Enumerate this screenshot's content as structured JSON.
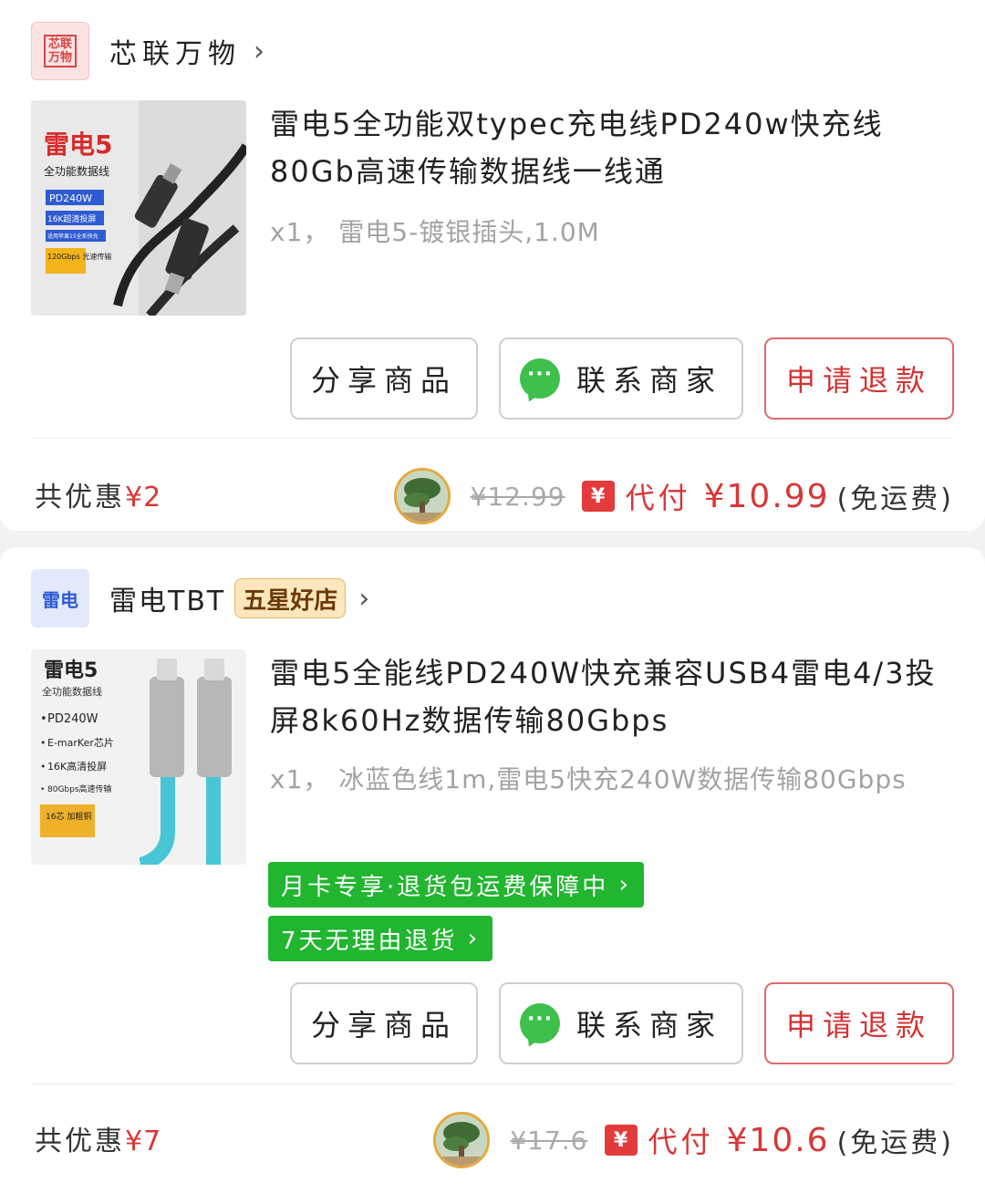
{
  "colors": {
    "accent_red": "#d93636",
    "green_tag": "#21b530",
    "wechat_green": "#3ec04c"
  },
  "orders": [
    {
      "shop": {
        "logo_text": "芯联万物",
        "name": "芯联万物",
        "badge": ""
      },
      "product": {
        "title": "雷电5全功能双typec充电线PD240w快充线80Gb高速传输数据线一线通",
        "spec": "x1， 雷电5-镀银插头,1.0M",
        "image_text": {
          "heading": "雷电5",
          "sub": "全功能数据线",
          "tags": [
            "PD240W",
            "16K超清投屏",
            "适用苹果15全系快充",
            "120Gbps 光速传输"
          ]
        }
      },
      "buttons": {
        "share": "分享商品",
        "contact": "联系商家",
        "refund": "申请退款"
      },
      "summary": {
        "discount_label": "共优惠",
        "discount_amount": "¥2",
        "original_price": "¥12.99",
        "pay_badge": "¥",
        "pay_label": "代付",
        "final_price": "¥10.99",
        "shipping": "(免运费)"
      }
    },
    {
      "shop": {
        "logo_text": "雷电",
        "name": "雷电TBT",
        "badge": "五星好店"
      },
      "product": {
        "title": "雷电5全能线PD240W快充兼容USB4雷电4/3投屏8k60Hz数据传输80Gbps",
        "spec": "x1， 冰蓝色线1m,雷电5快充240W数据传输80Gbps",
        "tags": [
          "月卡专享·退货包运费保障中",
          "7天无理由退货"
        ],
        "image_text": {
          "heading": "雷电5",
          "sub": "全功能数据线",
          "bullets": [
            "PD240W",
            "E-marKer芯片",
            "16K高清投屏",
            "80Gbps高速传输"
          ],
          "corner": "16芯 加粗铜"
        }
      },
      "buttons": {
        "share": "分享商品",
        "contact": "联系商家",
        "refund": "申请退款"
      },
      "summary": {
        "discount_label": "共优惠",
        "discount_amount": "¥7",
        "original_price": "¥17.6",
        "pay_badge": "¥",
        "pay_label": "代付",
        "final_price": "¥10.6",
        "shipping": "(免运费)"
      }
    }
  ],
  "icons": {
    "shop_chevron": "chevron-right-icon",
    "tag_chevron": "chevron-right-icon",
    "contact": "wechat-chat-icon"
  }
}
